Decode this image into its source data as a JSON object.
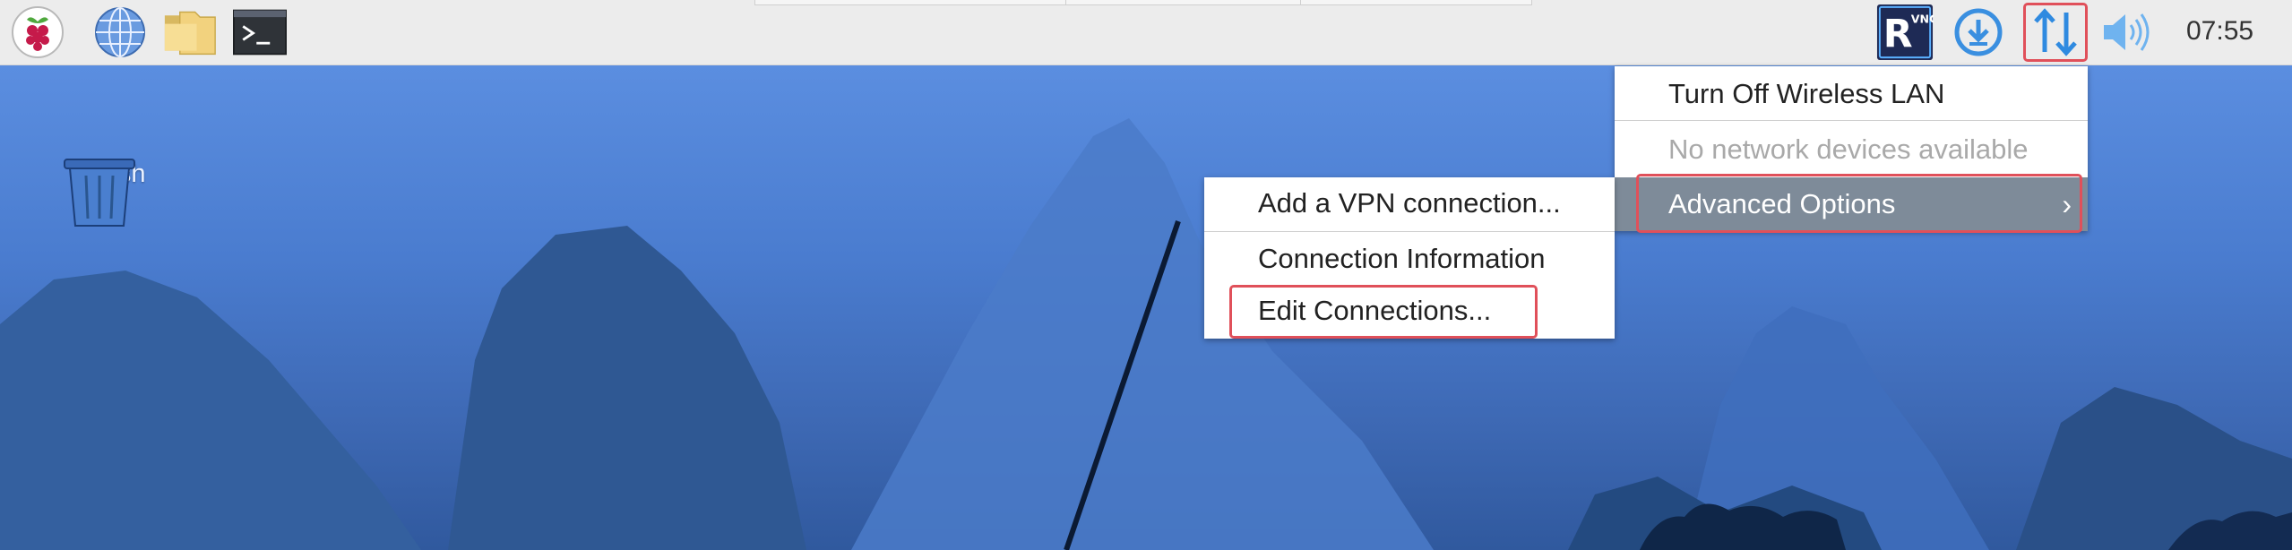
{
  "panel": {
    "launchers": [
      {
        "name": "raspberry-menu-icon"
      },
      {
        "name": "web-browser-icon"
      },
      {
        "name": "file-manager-icon"
      },
      {
        "name": "terminal-icon"
      }
    ],
    "tray": {
      "vnc_label": "VNC",
      "clock": "07:55"
    }
  },
  "desktop": {
    "trash_label": "Trash"
  },
  "network_menu": {
    "items": [
      {
        "label": "Turn Off Wireless LAN",
        "state": "normal"
      },
      {
        "label": "No network devices available",
        "state": "disabled"
      },
      {
        "label": "Advanced Options",
        "state": "selected"
      }
    ],
    "submenu_chevron": "›"
  },
  "advanced_submenu": {
    "items": [
      {
        "label": "Add a VPN connection..."
      },
      {
        "label": "Connection Information"
      },
      {
        "label": "Edit Connections..."
      }
    ]
  },
  "colors": {
    "highlight": "#e0505a",
    "selected_bg": "#7e8b99",
    "panel_bg": "#ececec"
  }
}
